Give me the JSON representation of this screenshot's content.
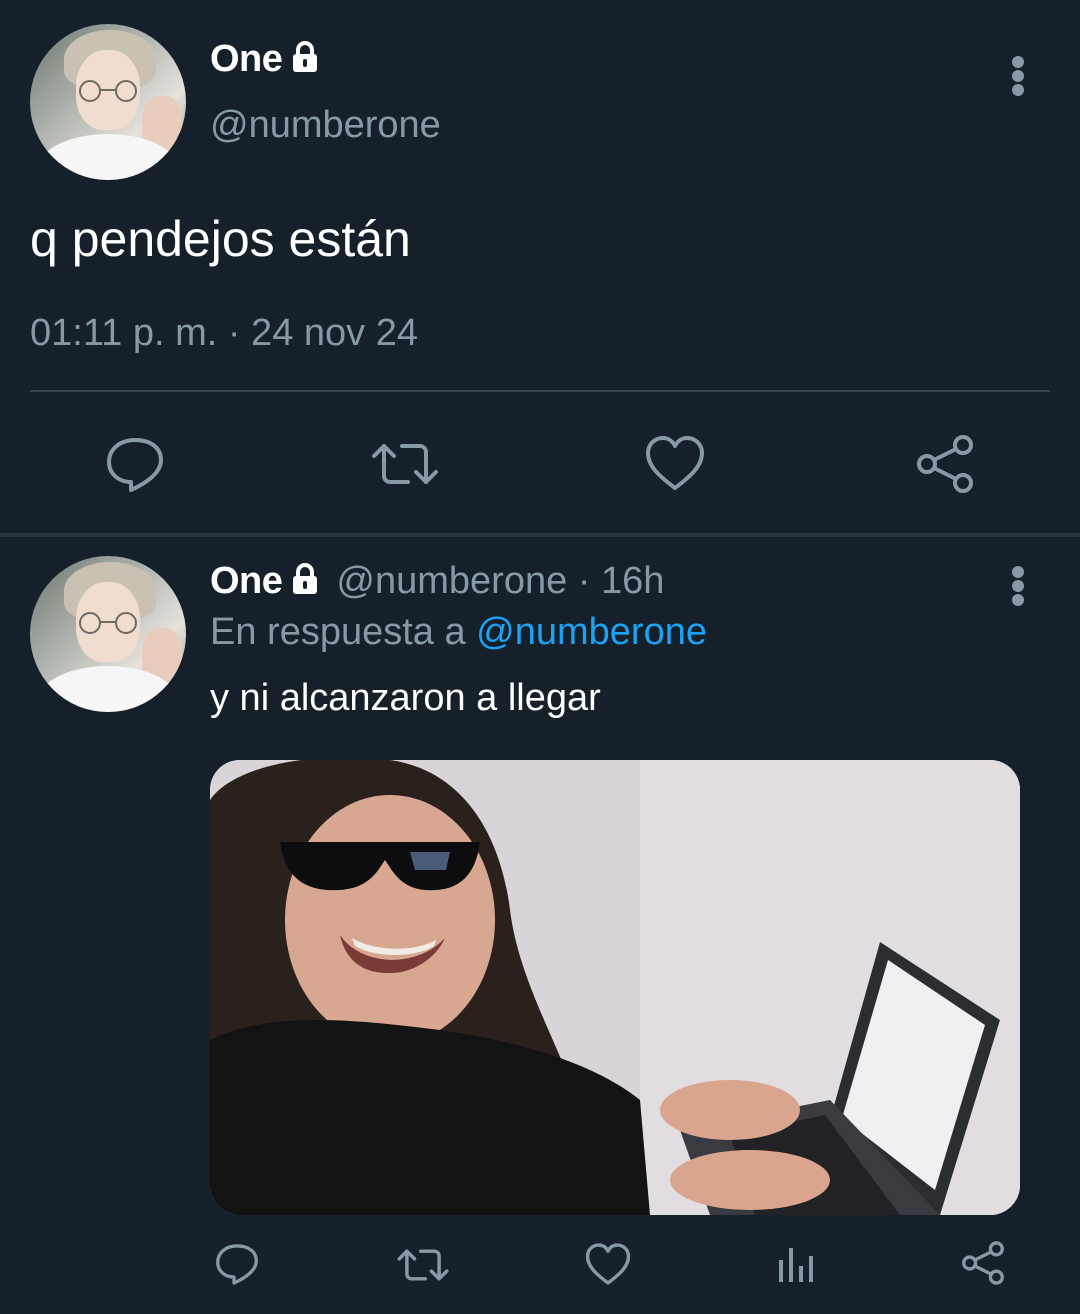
{
  "main_tweet": {
    "display_name": "One",
    "handle": "@numberone",
    "text": "q pendejos están",
    "timestamp": "01:11 p. m. · 24 nov 24",
    "actions": [
      "reply-icon",
      "retweet-icon",
      "like-icon",
      "share-icon"
    ]
  },
  "reply_tweet": {
    "display_name": "One",
    "handle_time": "@numberone · 16h",
    "in_reply_to_prefix": "En respuesta a",
    "in_reply_to_mention": "@numberone",
    "text": "y ni alcanzaron a llegar",
    "media_icon": "photo",
    "actions": [
      "reply-icon",
      "retweet-icon",
      "like-icon",
      "analytics-icon",
      "share-icon"
    ]
  },
  "colors": {
    "background": "#15202b",
    "secondary_text": "#8899a6",
    "link": "#1da1f2",
    "divider": "#38444d"
  }
}
